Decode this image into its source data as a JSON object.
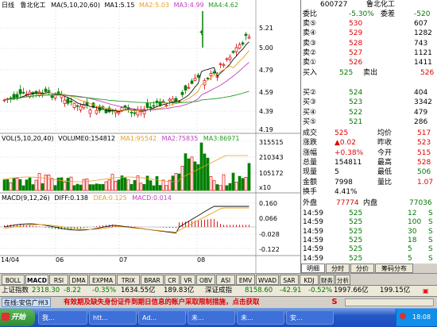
{
  "chart": {
    "period_label": "日线",
    "stock_name": "鲁北化工",
    "ma_title": "MA(5,10,20,60)",
    "ma1": "MA1:5.15",
    "ma2": "MA2:5.03",
    "ma3": "MA3:4.99",
    "ma4": "MA4:4.62",
    "price_ticks": [
      "5.21",
      "5.00",
      "4.79",
      "4.59",
      "4.39",
      "4.19"
    ],
    "vol_title": "VOL(5,10,20,40)",
    "vol_value": "VOLUME0:154812",
    "vol_ma1": "MA1:95542",
    "vol_ma2": "MA2:75835",
    "vol_ma3": "MA3:86971",
    "vol_ticks": [
      "315515",
      "210343",
      "105172",
      "x10"
    ],
    "macd_title": "MACD(9,12,26)",
    "macd_diff": "DIFF:0.138",
    "macd_dea": "DEA:0.125",
    "macd_macd": "MACD:0.014",
    "macd_ticks": [
      "0.160",
      "0.066",
      "-0.028",
      "-0.122"
    ],
    "date_labels": [
      "14/04",
      "06",
      "07",
      "08"
    ],
    "colors": {
      "up": "#e00000",
      "down": "#008000",
      "ma1": "#111111",
      "ma2": "#e8a020",
      "ma3": "#c040c0",
      "ma4": "#20a020"
    }
  },
  "tabs": [
    "BOLL",
    "MACD",
    "RSI",
    "DMA",
    "EXPMA",
    "TRIX",
    "BRAR",
    "CR",
    "VR",
    "OBV",
    "ASI",
    "EMV",
    "WVAD",
    "SAR",
    "KDJ",
    "财务",
    "分析"
  ],
  "quote": {
    "code": "600727",
    "name": "鲁北化工",
    "wei_bi_label": "委比",
    "wei_bi_pct": "-5.30%",
    "wei_cha_label": "委差",
    "wei_cha": "-520",
    "asks": [
      {
        "label": "卖⑤",
        "price": "530",
        "vol": "607"
      },
      {
        "label": "卖④",
        "price": "529",
        "vol": "1282"
      },
      {
        "label": "卖③",
        "price": "528",
        "vol": "743"
      },
      {
        "label": "卖②",
        "price": "527",
        "vol": "1121"
      },
      {
        "label": "卖①",
        "price": "526",
        "vol": "1411"
      }
    ],
    "buy_in_label": "买入",
    "buy_in": "525",
    "sell_out_label": "卖出",
    "sell_out": "526",
    "bids": [
      {
        "label": "买②",
        "price": "524",
        "vol": "404"
      },
      {
        "label": "买③",
        "price": "523",
        "vol": "3342"
      },
      {
        "label": "买④",
        "price": "522",
        "vol": "479"
      },
      {
        "label": "买⑤",
        "price": "521",
        "vol": "286"
      }
    ],
    "stats": [
      {
        "l1": "成交",
        "v1": "525",
        "l2": "均价",
        "v2": "517"
      },
      {
        "l1": "涨跌",
        "v1": "▲0.02",
        "l2": "昨收",
        "v2": "523"
      },
      {
        "l1": "涨幅",
        "v1": "+0.38%",
        "l2": "今开",
        "v2": "515"
      },
      {
        "l1": "总量",
        "v1": "154811",
        "l2": "最高",
        "v2": "528"
      },
      {
        "l1": "现量",
        "v1": "5",
        "l2": "最低",
        "v2": "506"
      },
      {
        "l1": "金额",
        "v1": "7998",
        "l2": "量比",
        "v2": "1.07"
      },
      {
        "l1": "换手",
        "v1": "4.41%",
        "l2": "",
        "v2": ""
      }
    ],
    "outer_label": "外盘",
    "outer": "77774",
    "inner_label": "内盘",
    "inner": "77036",
    "trades": [
      {
        "time": "14:59",
        "price": "525",
        "vol": "12",
        "side": "S"
      },
      {
        "time": "14:59",
        "price": "525",
        "vol": "100",
        "side": "S"
      },
      {
        "time": "14:59",
        "price": "525",
        "vol": "30",
        "side": "S"
      },
      {
        "time": "14:59",
        "price": "525",
        "vol": "18",
        "side": "S"
      },
      {
        "time": "14:59",
        "price": "525",
        "vol": "5",
        "side": "S"
      },
      {
        "time": "14:59",
        "price": "525",
        "vol": "5",
        "side": "S"
      }
    ],
    "bottom_tabs": [
      "明细",
      "分时",
      "分价",
      "筹码分布"
    ]
  },
  "status": {
    "idx1_label": "上证指数",
    "idx1_value": "2318.30",
    "idx1_change": "-8.22",
    "idx1_pct": "-0.35%",
    "idx1_amount": "1634.55亿",
    "idx2_amount": "189.83亿",
    "idx3_label": "深证成指",
    "idx3_value": "8158.60",
    "idx3_change": "-42.91",
    "idx3_pct": "-0.52%",
    "idx3_amount": "1997.66亿",
    "idx4_amount": "199.15亿"
  },
  "scroll_notice": "在线:安信广州3",
  "scroll_text": "有效期及缺失身份证件到期日信息的账户采取限制措施，点击获取",
  "taskbar": {
    "start": "开始",
    "buttons": [
      "我...",
      "htt...",
      "Ad...",
      "未...",
      "未...",
      "安..."
    ],
    "clock": "18:08"
  }
}
